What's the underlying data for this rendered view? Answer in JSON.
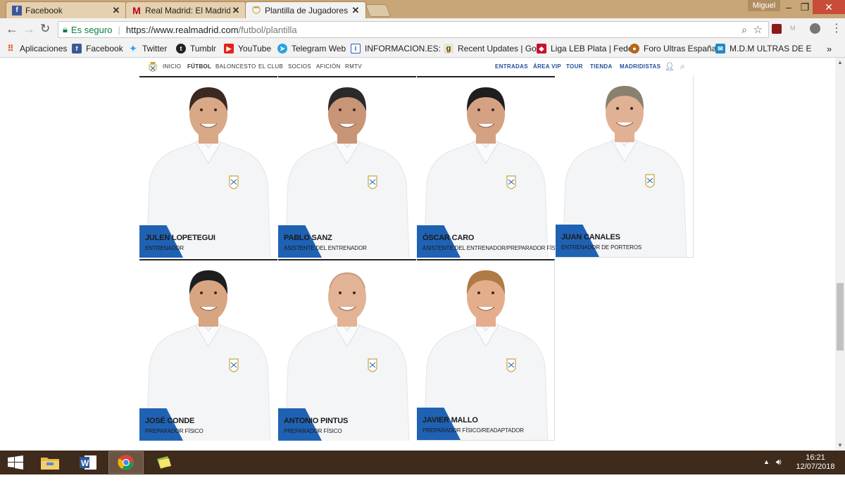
{
  "browser": {
    "tabs": [
      {
        "title": "Facebook",
        "icon": "facebook-icon"
      },
      {
        "title": "Real Madrid: El Madrid cc",
        "icon": "marca-icon"
      },
      {
        "title": "Plantilla de Jugadores de",
        "icon": "realmadrid-crest-icon"
      }
    ],
    "user": "Miguel",
    "window_controls": {
      "minimize": "–",
      "restore": "❐",
      "close": "✕"
    },
    "security_label": "Es seguro",
    "url_host": "https://www.realmadrid.com",
    "url_path": "/futbol/plantilla",
    "bookmarks": [
      {
        "label": "Aplicaciones",
        "icon": "apps-grid-icon"
      },
      {
        "label": "Facebook",
        "icon": "facebook-icon"
      },
      {
        "label": "Twitter",
        "icon": "twitter-icon"
      },
      {
        "label": "Tumblr",
        "icon": "tumblr-icon"
      },
      {
        "label": "YouTube",
        "icon": "youtube-icon"
      },
      {
        "label": "Telegram Web",
        "icon": "telegram-icon"
      },
      {
        "label": "INFORMACION.ES: N",
        "icon": "informacion-icon"
      },
      {
        "label": "Recent Updates | Go",
        "icon": "goodreads-icon"
      },
      {
        "label": "Liga LEB Plata | Fede",
        "icon": "liga-icon"
      },
      {
        "label": "Foro Ultras España",
        "icon": "foro-icon"
      },
      {
        "label": "M.D.M ULTRAS DE E",
        "icon": "chat-icon"
      }
    ],
    "more_bookmarks": "»"
  },
  "site_nav": {
    "left": [
      "INICIO",
      "FÚTBOL",
      "BALONCESTO",
      "EL CLUB",
      "SOCIOS",
      "AFICIÓN",
      "RMTV"
    ],
    "right": [
      "ENTRADAS",
      "ÁREA VIP",
      "TOUR",
      "TIENDA",
      "MADRIDISTAS"
    ]
  },
  "staff": [
    {
      "first": "JULEN",
      "last": "LOPETEGUI",
      "role": "ENTRENADOR"
    },
    {
      "first": "PABLO",
      "last": "SANZ",
      "role": "ASISTENTE DEL ENTRENADOR"
    },
    {
      "first": "ÓSCAR",
      "last": "CARO",
      "role": "ASISTENTE DEL ENTRENADOR/PREPARADOR FÍSICO"
    },
    {
      "first": "JUAN",
      "last": "CANALES",
      "role": "ENTRENADOR DE PORTEROS"
    },
    {
      "first": "JOSÉ",
      "last": "CONDE",
      "role": "PREPARADOR FÍSICO"
    },
    {
      "first": "ANTONIO",
      "last": "PINTUS",
      "role": "PREPARADOR FÍSICO"
    },
    {
      "first": "JAVIER",
      "last": "MALLO",
      "role": "PREPARADOR FÍSICO/READAPTADOR"
    }
  ],
  "taskbar": {
    "time": "16:21",
    "date": "12/07/2018",
    "apps": [
      "windows-start-icon",
      "file-explorer-icon",
      "word-icon",
      "chrome-icon",
      "sticky-notes-icon"
    ]
  },
  "colors": {
    "accent_blue": "#1f62b4",
    "tab_bar": "#c9a677",
    "taskbar": "#3f2b1c"
  }
}
